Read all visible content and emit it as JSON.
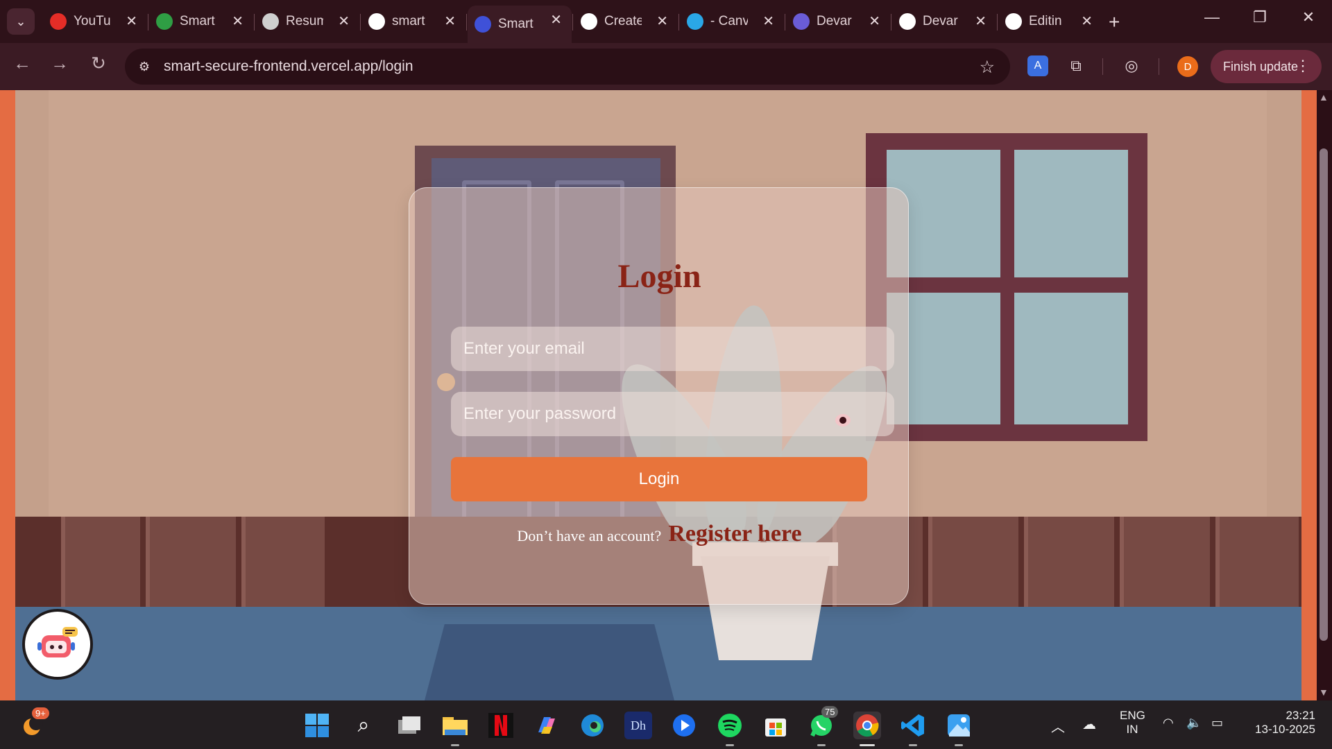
{
  "browser": {
    "tabs": [
      {
        "title": "YouTube",
        "favicon": "youtube-icon",
        "color": "#e52d27"
      },
      {
        "title": "Smart",
        "favicon": "smart-check-icon",
        "color": "#2f9e44"
      },
      {
        "title": "Resume",
        "favicon": "openai-icon",
        "color": "#cfcfcf"
      },
      {
        "title": "smart",
        "favicon": "vercel-icon",
        "color": "#ffffff"
      },
      {
        "title": "Smart",
        "favicon": "shield-icon",
        "color": "#3f51d8",
        "active": true
      },
      {
        "title": "Create",
        "favicon": "vercel-icon",
        "color": "#ffffff"
      },
      {
        "title": "- Canva",
        "favicon": "canva-icon",
        "color": "#2aa7e6"
      },
      {
        "title": "Devar",
        "favicon": "devar-icon",
        "color": "#6a5cd6"
      },
      {
        "title": "Devar",
        "favicon": "github-icon",
        "color": "#ffffff"
      },
      {
        "title": "Editin",
        "favicon": "github-icon",
        "color": "#ffffff"
      }
    ],
    "url": "smart-secure-frontend.vercel.app/login",
    "profile_initial": "D",
    "update_label": "Finish update"
  },
  "login": {
    "title": "Login",
    "email_placeholder": "Enter your email",
    "password_placeholder": "Enter your password",
    "button_label": "Login",
    "no_account_text": "Don’t have an account?",
    "register_link": "Register here"
  },
  "taskbar": {
    "weather_badge": "9+",
    "whatsapp_badge": "75",
    "language": "ENG",
    "region": "IN",
    "time": "23:21",
    "date": "13-10-2025"
  },
  "colors": {
    "accent_button": "#e8743b",
    "title_red": "#8a2316",
    "chrome_bg": "#3b1b24"
  }
}
